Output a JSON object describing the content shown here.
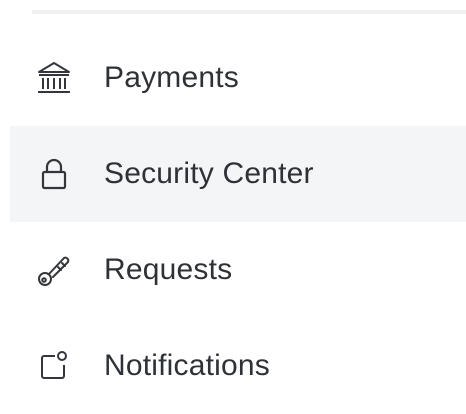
{
  "menu": {
    "items": [
      {
        "label": "Payments",
        "icon": "bank-icon",
        "active": false
      },
      {
        "label": "Security Center",
        "icon": "lock-icon",
        "active": true
      },
      {
        "label": "Requests",
        "icon": "key-icon",
        "active": false
      },
      {
        "label": "Notifications",
        "icon": "notification-icon",
        "active": false
      }
    ]
  },
  "colors": {
    "active_background": "#f3f5f7",
    "text": "#2e3237",
    "icon_stroke": "#33373b",
    "divider": "#eef0f2"
  }
}
